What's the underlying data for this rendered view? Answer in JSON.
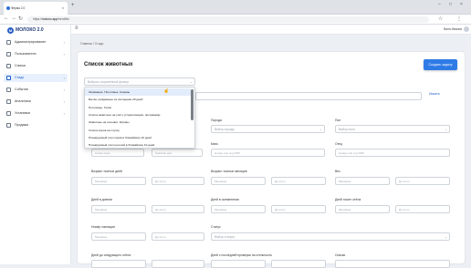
{
  "browser": {
    "tab_title": "Ферма 2.0",
    "url_prefix": "https://",
    "url_domain": "molono.app",
    "url_path": "/herd/list"
  },
  "app": {
    "logo": "МОЛОКО 2.0",
    "logo_mark": "M",
    "user": "Ваня Иванов"
  },
  "sidebar": {
    "items": [
      {
        "label": "Администрирование",
        "chev": "›"
      },
      {
        "label": "Пользователи",
        "chev": "›"
      },
      {
        "label": "Списки",
        "chev": ""
      },
      {
        "label": "Стадо",
        "chev": "›"
      },
      {
        "label": "События",
        "chev": "›"
      },
      {
        "label": "Аналитика",
        "chev": "›"
      },
      {
        "label": "Установки",
        "chev": "›"
      },
      {
        "label": "Продажи",
        "chev": ""
      }
    ]
  },
  "breadcrumb": "Главная  /  Стадо",
  "page": {
    "title": "Список животных",
    "create_button": "Создать задачу"
  },
  "filter": {
    "placeholder": "Выбрать сохранённый фильтр",
    "search": "Искать"
  },
  "dropdown": [
    "Заливание. Поголовье. Коровы",
    "Бычки, рождённые за последние 20 дней",
    "Поголовье. Телки",
    "Список животных на учёту (стерилизация, программа)",
    "Животные на лечении. Коровы",
    "Список коров на случку",
    "Планируемый отёл коров в ближайшие 10 дней",
    "Планируемый отёл нетелей в ближайшие 10 дней"
  ],
  "form": {
    "labels": {
      "breed": "Порода",
      "sex": "Пол",
      "mother": "Мать",
      "father": "Отец",
      "age_days": "Возраст полных дней",
      "age_months": "Возраст полных месяцев",
      "weight": "Вес",
      "days_milking": "Дней в доении",
      "days_insem": "Дней в осеменении",
      "days_after_calving": "Дней после отёла",
      "lactation": "Номер лактации",
      "status": "Статус",
      "days_to_calving": "Дней до следующего отёла",
      "days_since_check": "Дней с последней проверки на стельность",
      "lists": "Списки"
    },
    "placeholders": {
      "breed": "Выбор породы",
      "sex": "Выбор пола",
      "mother": "Номер или код ЯОР",
      "father": "Номер или код ЯОР",
      "from": "Минимум",
      "to": "До этого",
      "status": "Выбор статуса",
      "sub_left": "Номер кода",
      "sub_right": "Нажатие дня"
    }
  }
}
